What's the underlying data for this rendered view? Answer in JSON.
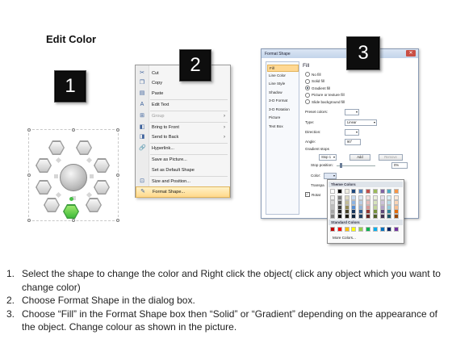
{
  "title": "Edit Color",
  "badges": [
    "1",
    "2",
    "3"
  ],
  "context_menu": {
    "items": [
      {
        "label": "Cut",
        "icon": "scissors-icon",
        "glyph": "✂"
      },
      {
        "label": "Copy",
        "icon": "copy-icon",
        "glyph": "❐"
      },
      {
        "label": "Paste",
        "icon": "paste-icon",
        "glyph": "▤"
      },
      {
        "label": "Edit Text",
        "icon": "edit-text-icon",
        "glyph": "A"
      },
      {
        "label": "Group",
        "icon": "group-icon",
        "glyph": "⊞"
      },
      {
        "label": "Bring to Front",
        "icon": "bring-front-icon",
        "glyph": "◧"
      },
      {
        "label": "Send to Back",
        "icon": "send-back-icon",
        "glyph": "◨"
      },
      {
        "label": "Hyperlink...",
        "icon": "hyperlink-icon",
        "glyph": "🔗"
      },
      {
        "label": "Save as Picture...",
        "icon": "",
        "glyph": ""
      },
      {
        "label": "Set as Default Shape",
        "icon": "",
        "glyph": ""
      },
      {
        "label": "Size and Position...",
        "icon": "size-position-icon",
        "glyph": "⊡"
      },
      {
        "label": "Format Shape...",
        "icon": "format-shape-icon",
        "glyph": "✎"
      }
    ]
  },
  "dialog": {
    "title": "Format Shape",
    "close_glyph": "✕",
    "categories": [
      "Fill",
      "Line Color",
      "Line Style",
      "Shadow",
      "3-D Format",
      "3-D Rotation",
      "Picture",
      "Text Box"
    ],
    "fill_header": "Fill",
    "fill_options": [
      "No fill",
      "Solid fill",
      "Gradient fill",
      "Picture or texture fill",
      "Slide background fill"
    ],
    "preset_colors_label": "Preset colors:",
    "type_label": "Type:",
    "type_value": "Linear",
    "direction_label": "Direction:",
    "angle_label": "Angle:",
    "angle_value": "90°",
    "gradient_stops_label": "Gradient stops",
    "stop_value": "Stop 1",
    "add_label": "Add",
    "remove_label": "Remove",
    "stop_position_label": "Stop position:",
    "stop_position_value": "0%",
    "color_label": "Color:",
    "transparency_label": "Transpa",
    "rotate_label": "Rotat"
  },
  "palette": {
    "theme_header": "Theme Colors",
    "standard_header": "Standard Colors",
    "more_label": "More Colors...",
    "theme_top": [
      "#ffffff",
      "#000000",
      "#eeece1",
      "#1f497d",
      "#4f81bd",
      "#c0504d",
      "#9bbb59",
      "#8064a2",
      "#4bacc6",
      "#f79646"
    ],
    "theme_shades": [
      [
        "#f2f2f2",
        "#7f7f7f",
        "#ddd9c3",
        "#c6d9f0",
        "#dbe5f1",
        "#f2dcdb",
        "#ebf1dd",
        "#e5e0ec",
        "#dbeef3",
        "#fdeada"
      ],
      [
        "#d8d8d8",
        "#595959",
        "#c4bd97",
        "#8db3e2",
        "#b8cce4",
        "#e5b9b7",
        "#d7e3bc",
        "#ccc1d9",
        "#b7dde8",
        "#fbd5b5"
      ],
      [
        "#bfbfbf",
        "#3f3f3f",
        "#938953",
        "#548dd4",
        "#95b3d7",
        "#d99694",
        "#c3d69b",
        "#b2a2c7",
        "#92cddc",
        "#fac08f"
      ],
      [
        "#a5a5a5",
        "#262626",
        "#494429",
        "#17365d",
        "#366092",
        "#953734",
        "#76923c",
        "#5f497a",
        "#31859b",
        "#e36c09"
      ],
      [
        "#7f7f7f",
        "#0c0c0c",
        "#1d1b10",
        "#0f243e",
        "#244061",
        "#632423",
        "#4f6128",
        "#3f3151",
        "#205867",
        "#974806"
      ]
    ],
    "standard": [
      "#c00000",
      "#ff0000",
      "#ffc000",
      "#ffff00",
      "#92d050",
      "#00b050",
      "#00b0f0",
      "#0070c0",
      "#002060",
      "#7030a0"
    ]
  },
  "instructions": [
    {
      "num": "1.",
      "text": "Select the shape to change the color and Right click the object( click any object which you want to change color)"
    },
    {
      "num": "2.",
      "text": "Choose Format Shape in the dialog box."
    },
    {
      "num": "3.",
      "text": "Choose “Fill” in the Format Shape box then “Solid” or “Gradient” depending on the appearance of the object. Change colour as shown in the picture."
    }
  ]
}
